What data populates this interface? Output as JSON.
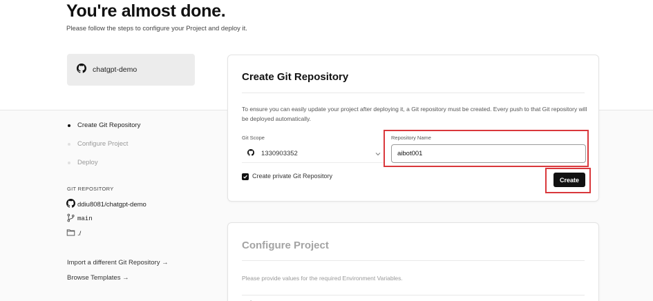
{
  "page": {
    "title": "You're almost done.",
    "subtitle": "Please follow the steps to configure your Project and deploy it."
  },
  "project": {
    "name": "chatgpt-demo",
    "icon": "github-icon"
  },
  "steps": [
    {
      "label": "Create Git Repository",
      "active": true
    },
    {
      "label": "Configure Project",
      "active": false
    },
    {
      "label": "Deploy",
      "active": false
    }
  ],
  "git_repository": {
    "heading": "GIT REPOSITORY",
    "repo": "ddiu8081/chatgpt-demo",
    "branch": "main",
    "root": "./"
  },
  "links": {
    "import_different": "Import a different Git Repository →",
    "browse_templates": "Browse Templates →"
  },
  "create_card": {
    "title": "Create Git Repository",
    "description": "To ensure you can easily update your project after deploying it, a Git repository must be created. Every push to that Git repository will be deployed automatically.",
    "git_scope_label": "Git Scope",
    "git_scope_value": "1330903352",
    "repo_name_label": "Repository Name",
    "repo_name_value": "aibot001",
    "private_checkbox_label": "Create private Git Repository",
    "private_checked": true,
    "create_button": "Create"
  },
  "configure_card": {
    "title": "Configure Project",
    "description": "Please provide values for the required Environment Variables."
  },
  "colors": {
    "highlight": "#d9373b",
    "primary_button": "#111111"
  }
}
